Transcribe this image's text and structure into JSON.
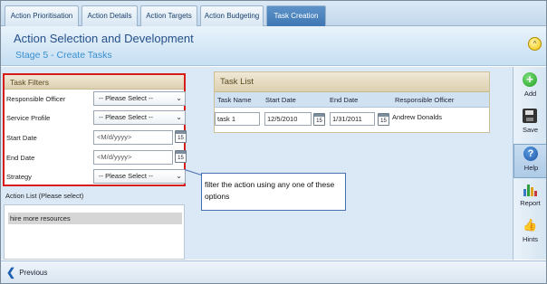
{
  "tabs": [
    {
      "label": "Action Prioritisation",
      "active": false
    },
    {
      "label": "Action Details",
      "active": false
    },
    {
      "label": "Action Targets",
      "active": false
    },
    {
      "label": "Action Budgeting",
      "active": false
    },
    {
      "label": "Task Creation",
      "active": true
    }
  ],
  "header": {
    "title": "Action Selection and Development",
    "subtitle": "Stage 5 - Create Tasks",
    "collapse_icon": "chevron-up-icon"
  },
  "filters": {
    "heading": "Task Filters",
    "responsible_officer": {
      "label": "Responsible Officer",
      "value": "-- Please Select --"
    },
    "service_profile": {
      "label": "Service Profile",
      "value": "-- Please Select --"
    },
    "start_date": {
      "label": "Start Date",
      "placeholder": "<M/d/yyyy>",
      "calendar_day": "15"
    },
    "end_date": {
      "label": "End Date",
      "placeholder": "<M/d/yyyy>",
      "calendar_day": "15"
    },
    "strategy": {
      "label": "Strategy",
      "value": "-- Please Select --"
    }
  },
  "action_list": {
    "label": "Action List (Please select)",
    "items": [
      "hire more resources"
    ]
  },
  "task_list": {
    "heading": "Task List",
    "columns": [
      "Task Name",
      "Start Date",
      "End Date",
      "Responsible Officer"
    ],
    "rows": [
      {
        "task_name": "task 1",
        "start_date": "12/5/2010",
        "end_date": "1/31/2011",
        "responsible_officer": "Andrew Donalds",
        "calendar_day": "15"
      }
    ]
  },
  "callout": {
    "text": "filter the action using any one of these options"
  },
  "toolbar": {
    "add": "Add",
    "save": "Save",
    "help": "Help",
    "report": "Report",
    "hints": "Hints"
  },
  "footer": {
    "previous": "Previous"
  },
  "colors": {
    "accent": "#3f77b3",
    "highlight_border": "#d81c1c",
    "panel_background": "#dbe9f6"
  }
}
